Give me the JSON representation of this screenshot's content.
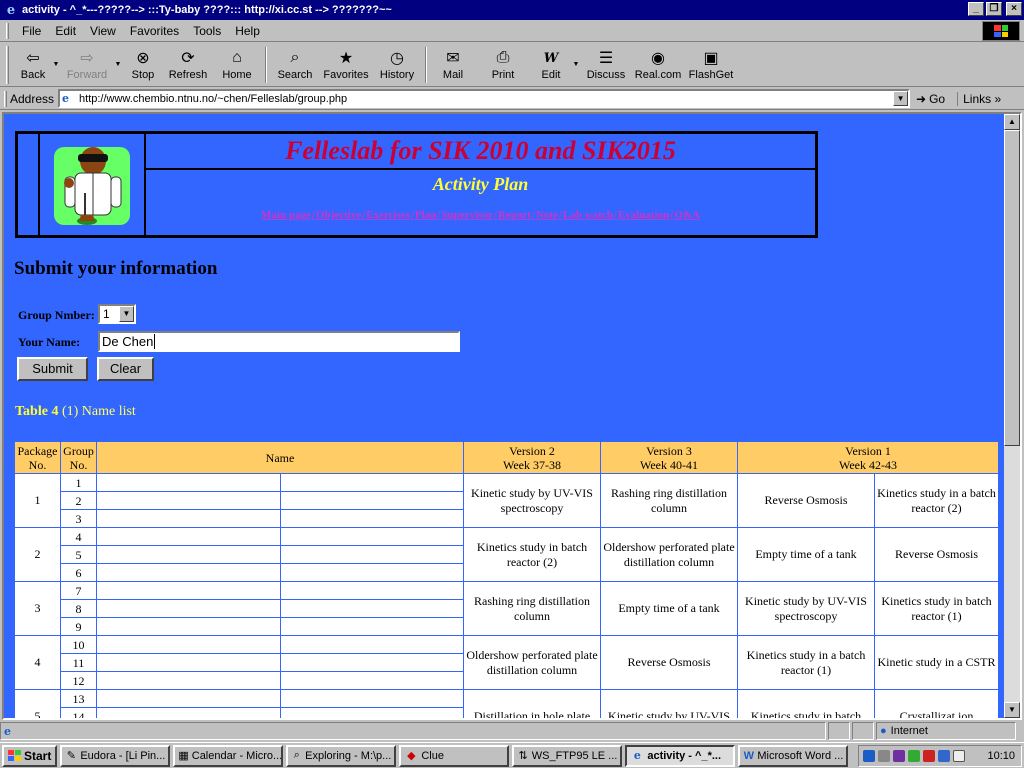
{
  "window": {
    "title": "activity - ^_*---?????-->  :::Ty-baby ????:::  http://xi.cc.st -->  ???????~~",
    "btn_min": "_",
    "btn_restore": "❐",
    "btn_close": "×"
  },
  "menubar": {
    "items": [
      "File",
      "Edit",
      "View",
      "Favorites",
      "Tools",
      "Help"
    ]
  },
  "toolbar": {
    "buttons": [
      {
        "label": "Back",
        "icon": "back-arrow-icon"
      },
      {
        "label": "Forward",
        "icon": "forward-arrow-icon"
      },
      {
        "label": "Stop",
        "icon": "stop-icon"
      },
      {
        "label": "Refresh",
        "icon": "refresh-icon"
      },
      {
        "label": "Home",
        "icon": "home-icon"
      },
      {
        "label": "Search",
        "icon": "search-icon"
      },
      {
        "label": "Favorites",
        "icon": "favorites-icon"
      },
      {
        "label": "History",
        "icon": "history-icon"
      },
      {
        "label": "Mail",
        "icon": "mail-icon"
      },
      {
        "label": "Print",
        "icon": "print-icon"
      },
      {
        "label": "Edit",
        "icon": "edit-icon"
      },
      {
        "label": "Discuss",
        "icon": "discuss-icon"
      },
      {
        "label": "Real.com",
        "icon": "realcom-icon"
      },
      {
        "label": "FlashGet",
        "icon": "flashget-icon"
      }
    ]
  },
  "address": {
    "label": "Address",
    "url": "http://www.chembio.ntnu.no/~chen/Felleslab/group.php",
    "go": "Go",
    "links": "Links"
  },
  "page": {
    "header": {
      "title": "Felleslab for SIK 2010 and SIK2015",
      "subtitle": "Activity Plan",
      "nav": [
        "Main page",
        "Objective",
        "Exercises",
        "Plan",
        "Supervisor",
        "Report",
        "Note",
        "Lab watch",
        "Evaluation",
        "Q&A"
      ]
    },
    "form": {
      "heading": "Submit your information",
      "group_label": "Group Nmber:",
      "group_value": "1",
      "name_label": "Your Name:",
      "name_value": "De Chen",
      "submit": "Submit",
      "clear": "Clear"
    },
    "table": {
      "caption_bold": "Table 4",
      "caption_rest": " (1) Name list",
      "headers": {
        "package": "Package No.",
        "group": "Group No.",
        "name": "Name",
        "v2": "Version 2",
        "v2_week": "Week 37-38",
        "v3": "Version 3",
        "v3_week": "Week 40-41",
        "v1": "Version 1",
        "v1_week": "Week 42-43"
      },
      "packages": [
        {
          "no": "1",
          "groups": [
            "1",
            "2",
            "3"
          ],
          "v2": "Kinetic study by UV-VIS spectroscopy",
          "v3": "Rashing ring distillation column",
          "v1a": "Reverse Osmosis",
          "v1b": "Kinetics study in a batch reactor (2)"
        },
        {
          "no": "2",
          "groups": [
            "4",
            "5",
            "6"
          ],
          "v2": "Kinetics study in batch reactor (2)",
          "v3": "Oldershow perforated plate distillation column",
          "v1a": "Empty time of a tank",
          "v1b": "Reverse Osmosis"
        },
        {
          "no": "3",
          "groups": [
            "7",
            "8",
            "9"
          ],
          "v2": "Rashing ring distillation column",
          "v3": "Empty time of a tank",
          "v1a": "Kinetic study by UV-VIS spectroscopy",
          "v1b": "Kinetics study in batch reactor (1)"
        },
        {
          "no": "4",
          "groups": [
            "10",
            "11",
            "12"
          ],
          "v2": "Oldershow perforated plate distillation column",
          "v3": "Reverse Osmosis",
          "v1a": "Kinetics study in a batch reactor (1)",
          "v1b": "Kinetic study in a CSTR"
        },
        {
          "no": "5",
          "groups": [
            "13",
            "14",
            ""
          ],
          "v2": "Distillation in hole plate",
          "v3": "Kinetic study by UV-VIS",
          "v1a": "Kinetics study in batch",
          "v1b": "Crystallizat ion"
        }
      ]
    }
  },
  "statusbar": {
    "zone": "Internet"
  },
  "taskbar": {
    "start": "Start",
    "tasks": [
      {
        "label": "Eudora - [Li Pin...",
        "icon": "eudora-icon"
      },
      {
        "label": "Calendar - Micro...",
        "icon": "calendar-icon"
      },
      {
        "label": "Exploring - M:\\p...",
        "icon": "explorer-icon"
      },
      {
        "label": "Clue",
        "icon": "clue-icon"
      },
      {
        "label": "WS_FTP95 LE ...",
        "icon": "ftp-icon"
      },
      {
        "label": "activity - ^_*...",
        "icon": "ie-icon"
      },
      {
        "label": "Microsoft Word ...",
        "icon": "word-icon"
      }
    ],
    "clock": "10:10"
  }
}
